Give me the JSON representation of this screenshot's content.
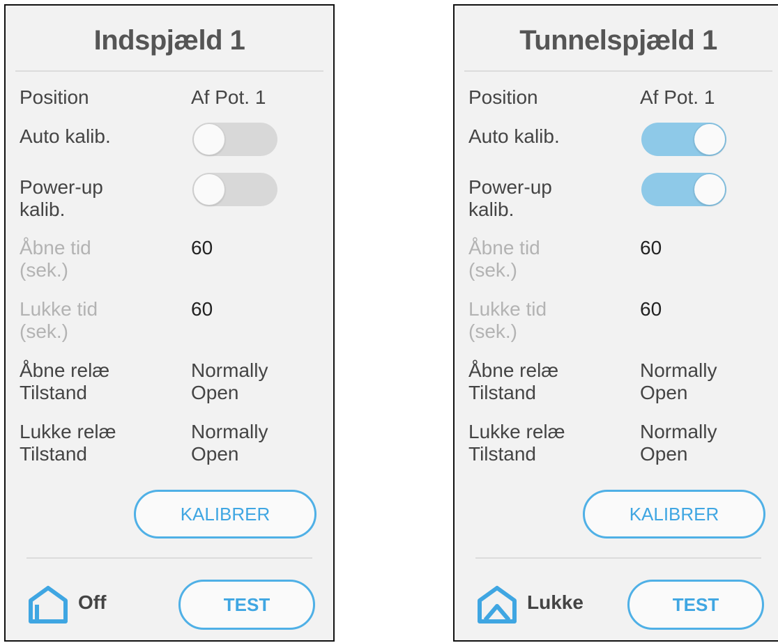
{
  "colors": {
    "accent": "#3fa6e2",
    "toggle_on": "#8ec9e8",
    "toggle_off": "#d8d8d8",
    "panel_bg": "#f2f2f2"
  },
  "panels": [
    {
      "title": "Indspjæld 1",
      "position_label": "Position",
      "position_value": "Af Pot. 1",
      "auto_calib_label": "Auto kalib.",
      "auto_calib_on": false,
      "powerup_label_1": "Power-up",
      "powerup_label_2": "kalib.",
      "powerup_on": false,
      "open_time_label_1": "Åbne tid",
      "open_time_label_2": "(sek.)",
      "open_time_value": "60",
      "close_time_label_1": "Lukke tid",
      "close_time_label_2": "(sek.)",
      "close_time_value": "60",
      "open_relay_label_1": "Åbne relæ",
      "open_relay_label_2": "Tilstand",
      "open_relay_value_1": "Normally",
      "open_relay_value_2": "Open",
      "close_relay_label_1": "Lukke relæ",
      "close_relay_label_2": "Tilstand",
      "close_relay_value_1": "Normally",
      "close_relay_value_2": "Open",
      "calibrate_button": "KALIBRER",
      "status_icon": "house-icon",
      "status_text": "Off",
      "test_button": "TEST"
    },
    {
      "title": "Tunnelspjæld 1",
      "position_label": "Position",
      "position_value": "Af Pot. 1",
      "auto_calib_label": "Auto kalib.",
      "auto_calib_on": true,
      "powerup_label_1": "Power-up",
      "powerup_label_2": "kalib.",
      "powerup_on": true,
      "open_time_label_1": "Åbne tid",
      "open_time_label_2": "(sek.)",
      "open_time_value": "60",
      "close_time_label_1": "Lukke tid",
      "close_time_label_2": "(sek.)",
      "close_time_value": "60",
      "open_relay_label_1": "Åbne relæ",
      "open_relay_label_2": "Tilstand",
      "open_relay_value_1": "Normally",
      "open_relay_value_2": "Open",
      "close_relay_label_1": "Lukke relæ",
      "close_relay_label_2": "Tilstand",
      "close_relay_value_1": "Normally",
      "close_relay_value_2": "Open",
      "calibrate_button": "KALIBRER",
      "status_icon": "tunnel-closed-icon",
      "status_text": "Lukke",
      "test_button": "TEST"
    }
  ]
}
